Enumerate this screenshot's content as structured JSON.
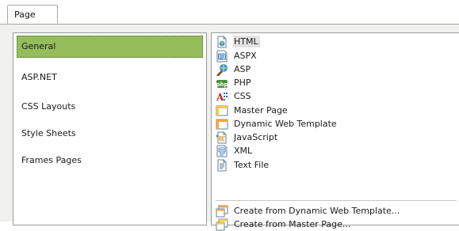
{
  "tabs": [
    {
      "label": "Page"
    }
  ],
  "categories": [
    {
      "label": "General"
    },
    {
      "label": "ASP.NET"
    },
    {
      "label": "CSS Layouts"
    },
    {
      "label": "Style Sheets"
    },
    {
      "label": "Frames Pages"
    }
  ],
  "templates": [
    {
      "label": "HTML",
      "icon": "html-page-icon"
    },
    {
      "label": "ASPX",
      "icon": "aspx-page-icon"
    },
    {
      "label": "ASP",
      "icon": "asp-page-icon"
    },
    {
      "label": "PHP",
      "icon": "php-page-icon"
    },
    {
      "label": "CSS",
      "icon": "css-file-icon"
    },
    {
      "label": "Master Page",
      "icon": "master-page-icon"
    },
    {
      "label": "Dynamic Web Template",
      "icon": "dynamic-web-template-icon"
    },
    {
      "label": "JavaScript",
      "icon": "javascript-file-icon"
    },
    {
      "label": "XML",
      "icon": "xml-file-icon"
    },
    {
      "label": "Text File",
      "icon": "text-file-icon"
    }
  ],
  "create_options": [
    {
      "label": "Create from Dynamic Web Template...",
      "icon": "create-from-dwt-icon"
    },
    {
      "label": "Create from Master Page...",
      "icon": "create-from-master-page-icon"
    }
  ],
  "colors": {
    "selected_category_bg": "#95bd5c",
    "selected_item_bg": "#e3e3e3",
    "panel_bg": "#f0f0ef"
  }
}
